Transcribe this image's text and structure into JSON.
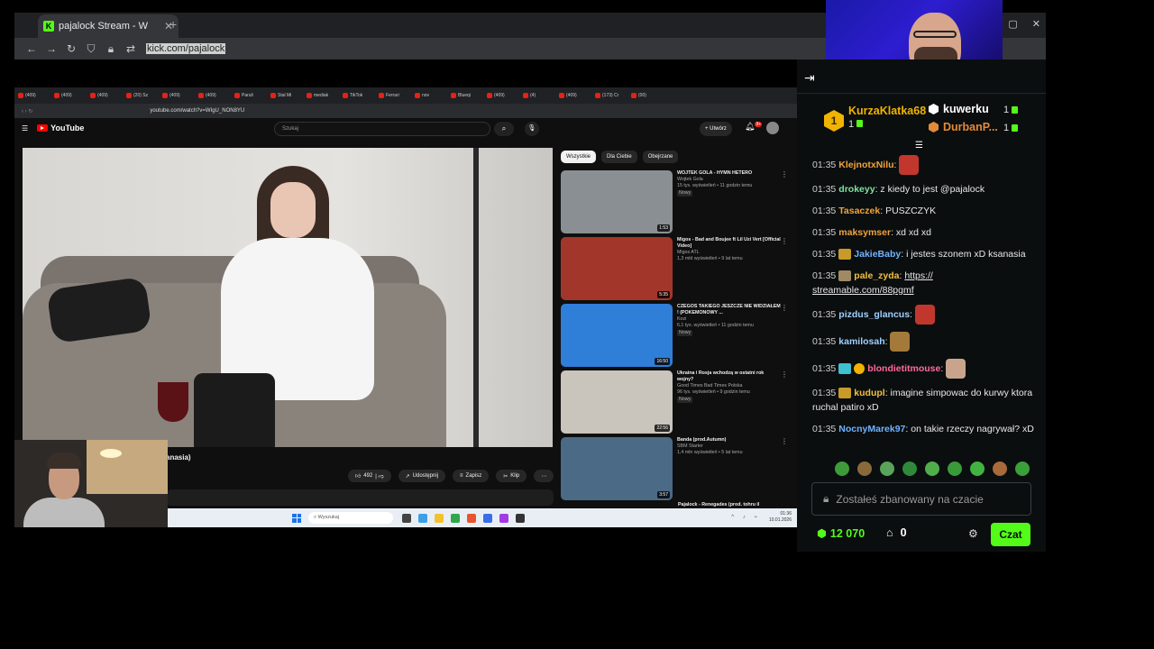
{
  "browser": {
    "tab_title": "pajalock Stream - W",
    "url": "kick.com/pajalock"
  },
  "inner_browser": {
    "tab_labels": [
      "(409)",
      "(409)",
      "(409)",
      "(20) Sz",
      "(409)",
      "(409)",
      "Paruli",
      "Stal Mi",
      "mediak",
      "TikTok",
      "Ferrari",
      "nov",
      "Blueqi",
      "(409)",
      "(4)",
      "(409)",
      "(173) Cr",
      "(00)"
    ],
    "url": "youtube.com/watch?v=WIgU_NON8YU"
  },
  "youtube": {
    "logo": "YouTube",
    "search_placeholder": "Szukaj",
    "create_label": "Utwórz",
    "notif_count": "9+",
    "title_fragment": "anasia)",
    "likes": "492",
    "share": "Udostępnij",
    "save": "Zapisz",
    "clip": "Klip",
    "chips": [
      "Wszystkie",
      "Dla Ciebie",
      "Obejrzane"
    ],
    "related": [
      {
        "title": "WOJTEK GOLA - HYMN HETERO",
        "channel": "Wojtek Gola",
        "stats": "15 tys. wyświetleń • 11 godzin temu",
        "badge": "Nowy",
        "duration": "1:53",
        "color": "#8a8f93"
      },
      {
        "title": "Migos - Bad and Boujee ft Lil Uzi Vert [Official Video]",
        "channel": "Migos ATL",
        "stats": "1,3 mld wyświetleń • 9 lat temu",
        "badge": "",
        "duration": "5:35",
        "color": "#a3362a"
      },
      {
        "title": "CZEGOŚ TAKIEGO JESZCZE NIE WIDZIAŁEM ! (POKEMONOWY ...",
        "channel": "Kozi",
        "stats": "6,1 tys. wyświetleń • 11 godzin temu",
        "badge": "Nowy",
        "duration": "16:50",
        "color": "#2f7ed8"
      },
      {
        "title": "Ukraina i Rosja wchodzą w ostatni rok wojny?",
        "channel": "Good Times Bad Times Polska",
        "stats": "96 tys. wyświetleń • 9 godzin temu",
        "badge": "Nowy",
        "duration": "22:56",
        "color": "#c9c4bc"
      },
      {
        "title": "Banda (prod.Autumn)",
        "channel": "SBM Starter",
        "stats": "1,4 mln wyświetleń • 5 lat temu",
        "badge": "",
        "duration": "3:57",
        "color": "#4b6a86",
        "extra": "SBM Starter"
      }
    ],
    "next_title": "Pajalock - Renegades (prod. tohru il"
  },
  "taskbar": {
    "search": "Wyszukaj",
    "time": "01:36",
    "date": "10.01.2026"
  },
  "chat": {
    "top_gifter": {
      "rank": "1",
      "name": "KurzaKlatka68",
      "count": "1"
    },
    "gifter2": {
      "name": "kuwerku",
      "count": "1"
    },
    "gifter3": {
      "name": "DurbanP...",
      "count": "1"
    },
    "messages": [
      {
        "time": "01:35",
        "user": "KlejnotxNilu",
        "color": "#f0a43a",
        "text": "",
        "emote": "#c2372d"
      },
      {
        "time": "01:35",
        "user": "drokeyy",
        "color": "#7fe3a0",
        "text": "z kiedy to jest @pajalock"
      },
      {
        "time": "01:35",
        "user": "Tasaczek",
        "color": "#f0a43a",
        "text": "PUSZCZYK"
      },
      {
        "time": "01:35",
        "user": "maksymser",
        "color": "#f0a43a",
        "text": "xd xd xd"
      },
      {
        "time": "01:35",
        "user": "JakieBaby",
        "color": "#6fb3ff",
        "text": "i jestes szonem xD ksanasia",
        "badge": "#c79a2a"
      },
      {
        "time": "01:35",
        "user": "pale_zyda",
        "color": "#f0c040",
        "text": "https:// streamable.com/88pgmf",
        "badge": "#a08a66",
        "link": true
      },
      {
        "time": "01:35",
        "user": "pizdus_glancus",
        "color": "#9fd0ff",
        "text": "",
        "emote": "#c2372d"
      },
      {
        "time": "01:35",
        "user": "kamilosah",
        "color": "#9fd0ff",
        "text": "",
        "emote": "#a37a3a"
      },
      {
        "time": "01:35",
        "user": "blondietitmouse",
        "color": "#ff6b9a",
        "text": "",
        "emote": "#c9a48c",
        "badge": "#3fbfcf",
        "badge2": "#f0b400"
      },
      {
        "time": "01:35",
        "user": "kudupl",
        "color": "#f0c040",
        "text": "imagine simpowac do kurwy ktora ruchal patiro xD",
        "badge": "#c79a2a"
      },
      {
        "time": "01:35",
        "user": "NocnyMarek97",
        "color": "#6fb3ff",
        "text": "on takie rzeczy nagrywał? xD"
      }
    ],
    "emote_bar": [
      "#3d9c3a",
      "#8a6a3a",
      "#5aa35a",
      "#2e8a3a",
      "#4fae4a",
      "#3a9a3a",
      "#42b342",
      "#a86a3a",
      "#3aa03a"
    ],
    "input_placeholder": "Zostałeś zbanowany na czacie",
    "points": "12 070",
    "store_count": "0",
    "send_label": "Czat"
  }
}
